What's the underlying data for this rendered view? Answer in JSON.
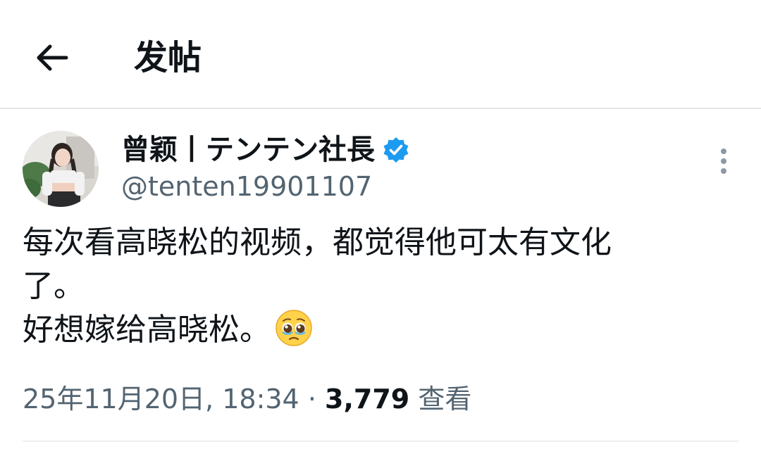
{
  "header": {
    "title": "发帖",
    "back_icon": "arrow-left-icon"
  },
  "tweet": {
    "author": {
      "display_name": "曾颖丨テンテン社長",
      "handle": "@tenten19901107",
      "verified": true,
      "verified_color": "#1d9bf0"
    },
    "text_lines": [
      "每次看高晓松的视频，都觉得他可太有文化",
      "了。",
      "好想嫁给高晓松。"
    ],
    "emoji": "pleading-face-icon",
    "timestamp": "25年11月20日, 18:34",
    "separator": "·",
    "views_count": "3,779",
    "views_label": "查看",
    "more_icon": "more-vertical-icon"
  },
  "colors": {
    "text_primary": "#0f1419",
    "text_secondary": "#536471",
    "divider": "#e4e6e8"
  }
}
